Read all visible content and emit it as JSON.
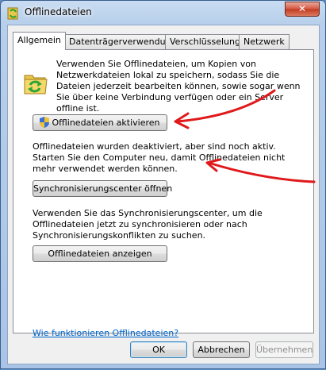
{
  "window": {
    "title": "Offlinedateien",
    "close_label": "✕"
  },
  "tabs": [
    {
      "label": "Allgemein",
      "active": true
    },
    {
      "label": "Datenträgerverwendung",
      "active": false
    },
    {
      "label": "Verschlüsselung",
      "active": false
    },
    {
      "label": "Netzwerk",
      "active": false
    }
  ],
  "general": {
    "intro_text": "Verwenden Sie Offlinedateien, um Kopien von Netzwerkdateien lokal zu speichern, sodass Sie die Dateien jederzeit bearbeiten können, sowie sogar wenn Sie über keine Verbindung verfügen oder ein Server offline ist.",
    "activate_button": "Offlinedateien aktivieren",
    "status_text": "Offlinedateien wurden deaktiviert, aber sind noch aktiv. Starten Sie den Computer neu, damit Offlinedateien nicht mehr verwendet werden können.",
    "sync_center_button": "Synchronisierungscenter öffnen",
    "sync_text": "Verwenden Sie das Synchronisierungscenter, um die Offlinedateien jetzt zu synchronisieren oder nach Synchronisierungskonflikten zu suchen.",
    "show_files_button": "Offlinedateien anzeigen",
    "help_link": "Wie funktionieren Offlinedateien?"
  },
  "footer": {
    "ok": "OK",
    "cancel": "Abbrechen",
    "apply": "Übernehmen"
  },
  "colors": {
    "annotation_arrow": "#e0191b",
    "link": "#0066cc"
  }
}
